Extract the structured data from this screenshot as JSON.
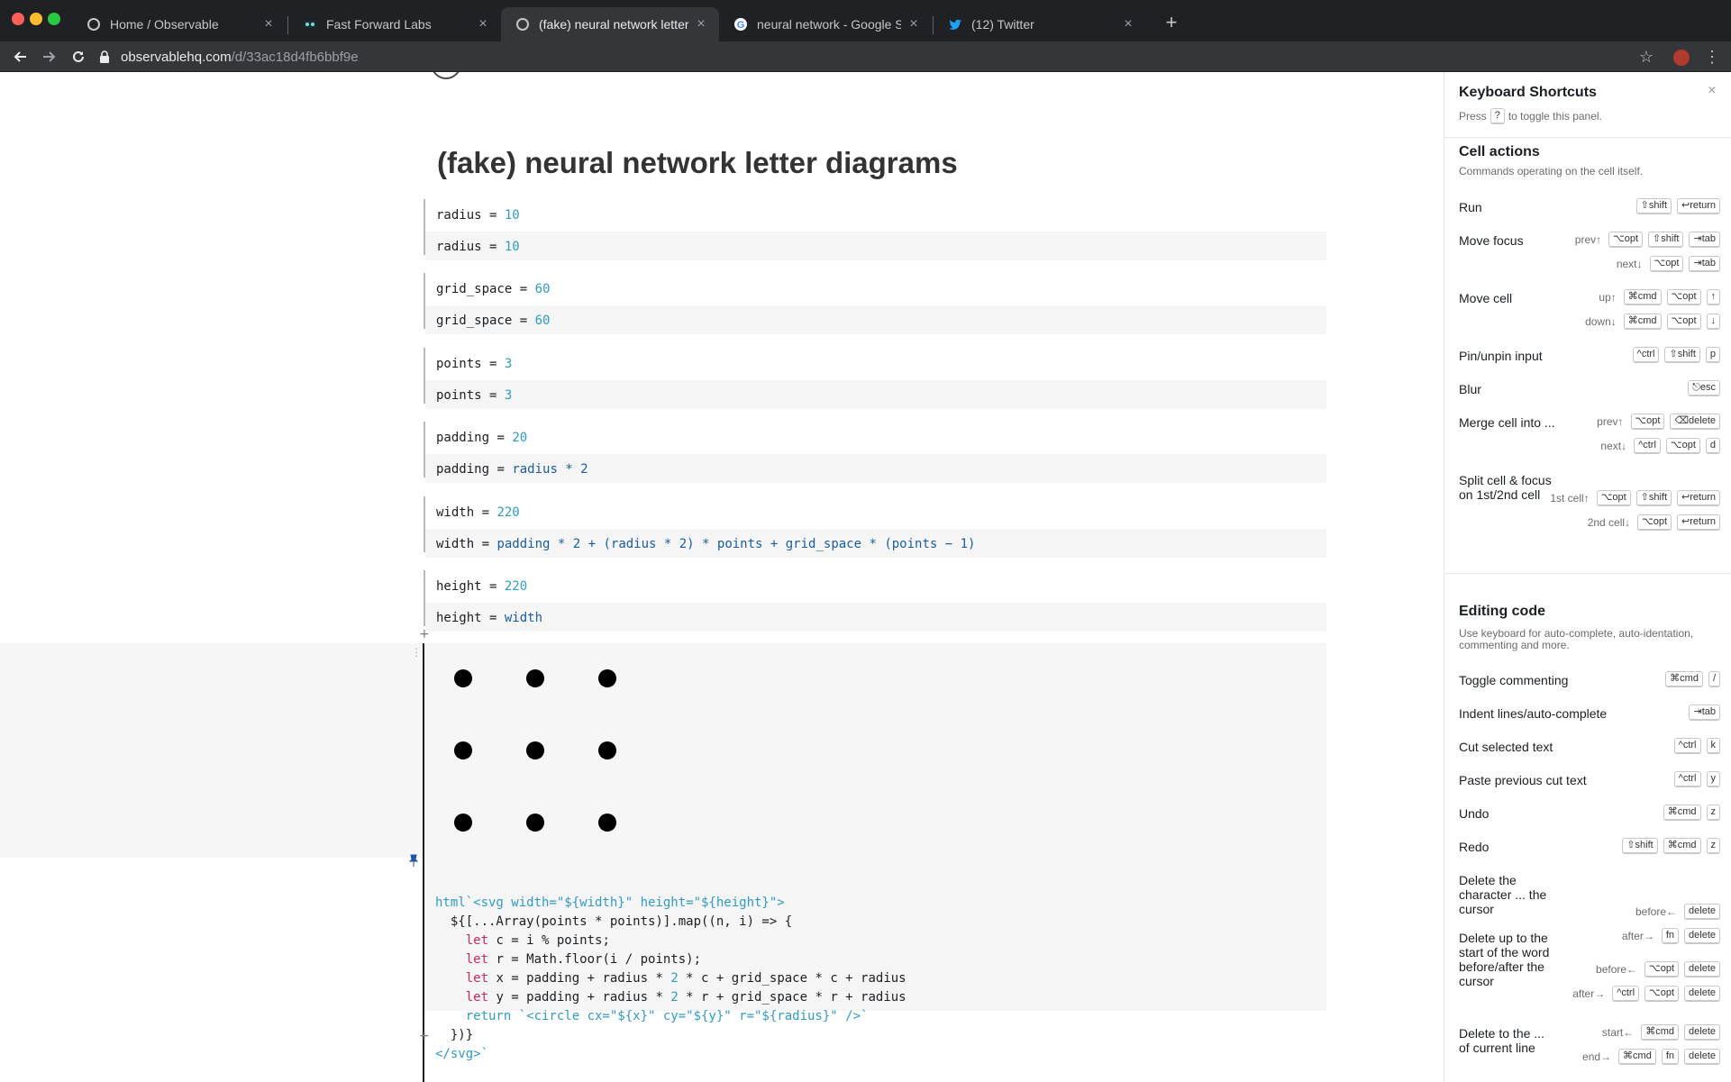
{
  "browser": {
    "tabs": [
      {
        "label": "Home / Observable",
        "icon": "observable-icon",
        "active": false
      },
      {
        "label": "Fast Forward Labs",
        "icon": "ffl-icon",
        "active": false
      },
      {
        "label": "(fake) neural network letter dia",
        "icon": "observable-icon",
        "active": true
      },
      {
        "label": "neural network - Google Searc",
        "icon": "google-icon",
        "active": false
      },
      {
        "label": "(12) Twitter",
        "icon": "twitter-icon",
        "active": false
      }
    ],
    "close_glyph": "×",
    "new_tab_glyph": "+",
    "url_host": "observablehq.com",
    "url_path": "/d/33ac18d4fb6bbf9e"
  },
  "notebook": {
    "title": "(fake) neural network letter diagrams",
    "cells": [
      {
        "output_name": "radius",
        "output_value": "10",
        "src_name": "radius",
        "src_expr": "10"
      },
      {
        "output_name": "grid_space",
        "output_value": "60",
        "src_name": "grid_space",
        "src_expr": "60"
      },
      {
        "output_name": "points",
        "output_value": "3",
        "src_name": "points",
        "src_expr": "3"
      },
      {
        "output_name": "padding",
        "output_value": "20",
        "src_name": "padding",
        "src_expr": "radius * 2"
      },
      {
        "output_name": "width",
        "output_value": "220",
        "src_name": "width",
        "src_expr": "padding * 2 + (radius * 2) * points + grid_space * (points − 1)"
      },
      {
        "output_name": "height",
        "output_value": "220",
        "src_name": "height",
        "src_expr": "width"
      }
    ],
    "svg_cell": {
      "points": 3,
      "code_lines": [
        "html`<svg width=\"${width}\" height=\"${height}\">",
        "  ${[...Array(points * points)].map((n, i) => {",
        "    let c = i % points;",
        "    let r = Math.floor(i / points);",
        "    let x = padding + radius * 2 * c + grid_space * c + radius",
        "    let y = padding + radius * 2 * r + grid_space * r + radius",
        "    return `<circle cx=\"${x}\" cy=\"${y}\" r=\"${radius}\" />`",
        "  })}",
        "</svg>`"
      ]
    }
  },
  "shortcuts": {
    "title": "Keyboard Shortcuts",
    "close_glyph": "×",
    "toggle_prefix": "Press",
    "toggle_key": "?",
    "toggle_suffix": "to toggle this panel.",
    "cell_actions": {
      "title": "Cell actions",
      "desc": "Commands operating on the cell itself.",
      "items": [
        {
          "label": "Run",
          "rows": [
            {
              "mod": "",
              "keys": [
                "⇧shift",
                "↩return"
              ]
            }
          ]
        },
        {
          "label": "Move focus",
          "rows": [
            {
              "mod": "prev↑",
              "keys": [
                "⌥opt",
                "⇧shift",
                "⇥tab"
              ]
            },
            {
              "mod": "next↓",
              "keys": [
                "⌥opt",
                "⇥tab"
              ]
            }
          ]
        },
        {
          "label": "Move cell",
          "rows": [
            {
              "mod": "up↑",
              "keys": [
                "⌘cmd",
                "⌥opt",
                "↑"
              ]
            },
            {
              "mod": "down↓",
              "keys": [
                "⌘cmd",
                "⌥opt",
                "↓"
              ]
            }
          ]
        },
        {
          "label": "Pin/unpin input",
          "rows": [
            {
              "mod": "",
              "keys": [
                "^ctrl",
                "⇧shift",
                "p"
              ]
            }
          ]
        },
        {
          "label": "Blur",
          "rows": [
            {
              "mod": "",
              "keys": [
                "⎋esc"
              ]
            }
          ]
        },
        {
          "label": "Merge cell into ...",
          "rows": [
            {
              "mod": "prev↑",
              "keys": [
                "⌥opt",
                "⌫delete"
              ]
            },
            {
              "mod": "next↓",
              "keys": [
                "^ctrl",
                "⌥opt",
                "d"
              ]
            }
          ]
        },
        {
          "label": "Split cell & focus on 1st/2nd cell",
          "rows": [
            {
              "mod": "1st cell↑",
              "keys": [
                "⌥opt",
                "⇧shift",
                "↩return"
              ]
            },
            {
              "mod": "2nd cell↓",
              "keys": [
                "⌥opt",
                "↩return"
              ]
            }
          ]
        }
      ]
    },
    "editing": {
      "title": "Editing code",
      "desc": "Use keyboard for auto-complete, auto-identation, commenting and more.",
      "items": [
        {
          "label": "Toggle commenting",
          "rows": [
            {
              "mod": "",
              "keys": [
                "⌘cmd",
                "/"
              ]
            }
          ]
        },
        {
          "label": "Indent lines/auto-complete",
          "rows": [
            {
              "mod": "",
              "keys": [
                "⇥tab"
              ]
            }
          ]
        },
        {
          "label": "Cut selected text",
          "rows": [
            {
              "mod": "",
              "keys": [
                "^ctrl",
                "k"
              ]
            }
          ]
        },
        {
          "label": "Paste previous cut text",
          "rows": [
            {
              "mod": "",
              "keys": [
                "^ctrl",
                "y"
              ]
            }
          ]
        },
        {
          "label": "Undo",
          "rows": [
            {
              "mod": "",
              "keys": [
                "⌘cmd",
                "z"
              ]
            }
          ]
        },
        {
          "label": "Redo",
          "rows": [
            {
              "mod": "",
              "keys": [
                "⇧shift",
                "⌘cmd",
                "z"
              ]
            }
          ]
        },
        {
          "label": "Delete the character ... the cursor",
          "rows": [
            {
              "mod": "before←",
              "keys": [
                "delete"
              ]
            },
            {
              "mod": "after→",
              "keys": [
                "fn",
                "delete"
              ]
            }
          ]
        },
        {
          "label": "Delete up to the start of the word before/after the cursor",
          "rows": [
            {
              "mod": "before←",
              "keys": [
                "⌥opt",
                "delete"
              ]
            },
            {
              "mod": "after→",
              "keys": [
                "^ctrl",
                "⌥opt",
                "delete"
              ]
            }
          ]
        },
        {
          "label": "Delete to the ... of current line",
          "rows": [
            {
              "mod": "start←",
              "keys": [
                "⌘cmd",
                "delete"
              ]
            },
            {
              "mod": "end→",
              "keys": [
                "⌘cmd",
                "fn",
                "delete"
              ]
            }
          ]
        }
      ]
    }
  },
  "colors": {
    "chrome_dark": "#202124",
    "chrome_tab": "#35363a",
    "number": "#2f9bc6",
    "variable": "#1b5da0",
    "keyword": "#c8265f"
  }
}
